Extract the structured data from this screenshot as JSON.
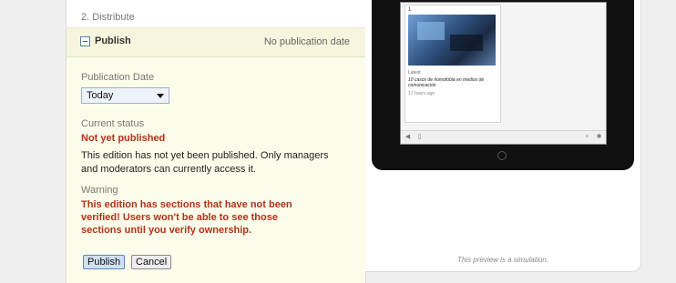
{
  "steps": {
    "distribute_label": "2. Distribute"
  },
  "publish_section": {
    "title": "Publish",
    "date_summary": "No publication date",
    "publication_date": {
      "label": "Publication Date",
      "selected": "Today"
    },
    "current_status": {
      "label": "Current status",
      "value": "Not yet published",
      "description": "This edition has not yet been published. Only managers and moderators can currently access it."
    },
    "warning": {
      "label": "Warning",
      "text": "This edition has sections that have not been verified! Users won't be able to see those sections until you verify ownership."
    },
    "buttons": {
      "publish": "Publish",
      "cancel": "Cancel"
    }
  },
  "preview": {
    "article": {
      "number": "1",
      "category": "Latest",
      "title": "10 casos de homofobia en medios de comunicación",
      "time": "17 hours ago"
    },
    "note": "This preview is a simulation."
  },
  "colors": {
    "warning_red": "#b1331a",
    "panel_yellow": "#fcfcea",
    "header_yellow": "#f6f5dd"
  }
}
